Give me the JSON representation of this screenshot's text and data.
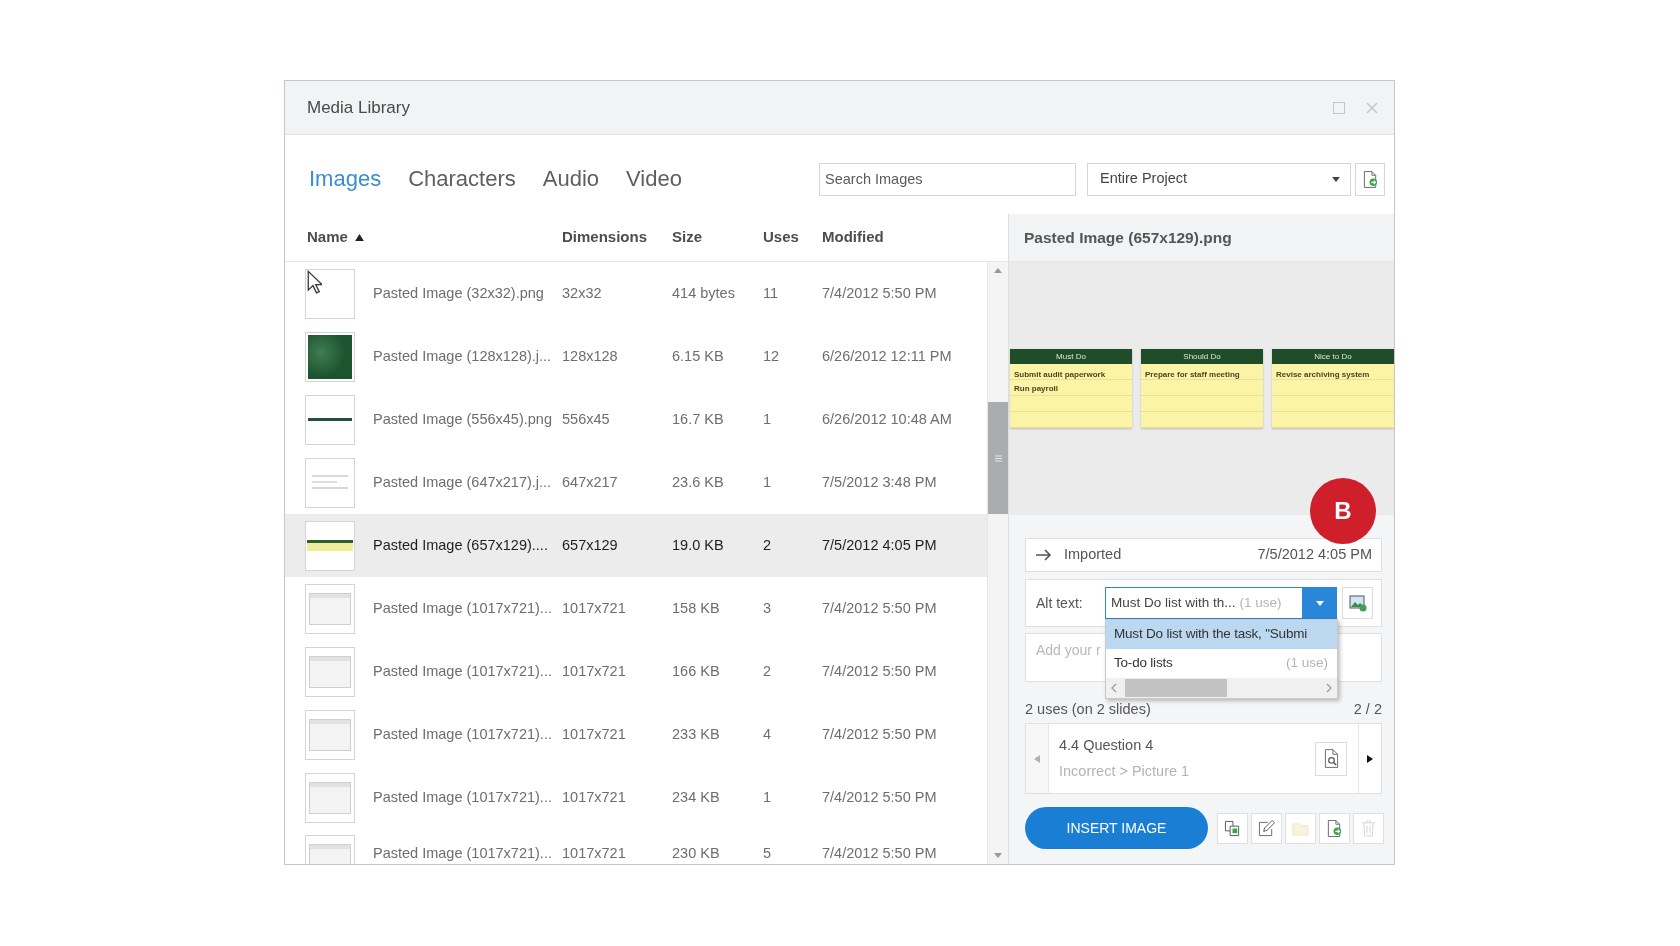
{
  "window": {
    "title": "Media Library"
  },
  "tabs": [
    {
      "label": "Images",
      "selected": true
    },
    {
      "label": "Characters",
      "selected": false
    },
    {
      "label": "Audio",
      "selected": false
    },
    {
      "label": "Video",
      "selected": false
    }
  ],
  "search": {
    "placeholder": "Search Images"
  },
  "scope": {
    "value": "Entire Project"
  },
  "table": {
    "columns": [
      {
        "label": "Name",
        "sorted_ascending": true
      },
      {
        "label": "Dimensions"
      },
      {
        "label": "Size"
      },
      {
        "label": "Uses"
      },
      {
        "label": "Modified"
      }
    ],
    "rows": [
      {
        "kind": "blank",
        "name": "Pasted Image (32x32).png",
        "dimensions": "32x32",
        "size": "414 bytes",
        "uses": "11",
        "modified": "7/4/2012 5:50 PM",
        "selected": false
      },
      {
        "kind": "texture",
        "name": "Pasted Image (128x128).j...",
        "dimensions": "128x128",
        "size": "6.15 KB",
        "uses": "12",
        "modified": "6/26/2012 12:11 PM",
        "selected": false
      },
      {
        "kind": "line",
        "name": "Pasted Image (556x45).png",
        "dimensions": "556x45",
        "size": "16.7 KB",
        "uses": "1",
        "modified": "6/26/2012 10:48 AM",
        "selected": false
      },
      {
        "kind": "document",
        "name": "Pasted Image (647x217).j...",
        "dimensions": "647x217",
        "size": "23.6 KB",
        "uses": "1",
        "modified": "7/5/2012 3:48 PM",
        "selected": false
      },
      {
        "kind": "notes",
        "name": "Pasted Image (657x129)....",
        "dimensions": "657x129",
        "size": "19.0 KB",
        "uses": "2",
        "modified": "7/5/2012 4:05 PM",
        "selected": true
      },
      {
        "kind": "screenshot",
        "name": "Pasted Image (1017x721)...",
        "dimensions": "1017x721",
        "size": "158 KB",
        "uses": "3",
        "modified": "7/4/2012 5:50 PM",
        "selected": false
      },
      {
        "kind": "screenshot",
        "name": "Pasted Image (1017x721)...",
        "dimensions": "1017x721",
        "size": "166 KB",
        "uses": "2",
        "modified": "7/4/2012 5:50 PM",
        "selected": false
      },
      {
        "kind": "screenshot",
        "name": "Pasted Image (1017x721)...",
        "dimensions": "1017x721",
        "size": "233 KB",
        "uses": "4",
        "modified": "7/4/2012 5:50 PM",
        "selected": false
      },
      {
        "kind": "screenshot",
        "name": "Pasted Image (1017x721)...",
        "dimensions": "1017x721",
        "size": "234 KB",
        "uses": "1",
        "modified": "7/4/2012 5:50 PM",
        "selected": false
      },
      {
        "kind": "screenshot",
        "name": "Pasted Image (1017x721)...",
        "dimensions": "1017x721",
        "size": "230 KB",
        "uses": "5",
        "modified": "7/4/2012 5:50 PM",
        "selected": false
      }
    ]
  },
  "details": {
    "title": "Pasted Image (657x129).png",
    "preview": {
      "notes": [
        {
          "heading": "Must Do",
          "items": [
            "Submit audit paperwork",
            "Run payroll"
          ]
        },
        {
          "heading": "Should Do",
          "items": [
            "Prepare for staff meeting"
          ]
        },
        {
          "heading": "Nice to Do",
          "items": [
            "Revise archiving system"
          ]
        }
      ]
    },
    "history": {
      "label": "Imported",
      "date": "7/5/2012 4:05 PM"
    },
    "alt_text": {
      "label": "Alt text:",
      "value": "Must Do list with th...",
      "count": "(1 use)",
      "options": [
        {
          "text": "Must Do list with the task, \"Submi",
          "selected": true
        },
        {
          "text": "To-do lists",
          "count": "(1 use)",
          "selected": false
        }
      ]
    },
    "notes_field": {
      "placeholder": "Add your r"
    },
    "usage": {
      "summary": "2 uses (on 2 slides)",
      "pager": "2 / 2",
      "previous_disabled": true,
      "next_disabled": false,
      "slide": "4.4 Question 4",
      "location": "Incorrect > Picture 1"
    },
    "insert_button": "INSERT IMAGE",
    "tools": [
      {
        "kind": "copy",
        "disabled": false
      },
      {
        "kind": "edit",
        "disabled": false
      },
      {
        "kind": "folder",
        "disabled": true
      },
      {
        "kind": "export",
        "disabled": false
      },
      {
        "kind": "delete",
        "disabled": true
      }
    ]
  },
  "callout_badge": "B"
}
